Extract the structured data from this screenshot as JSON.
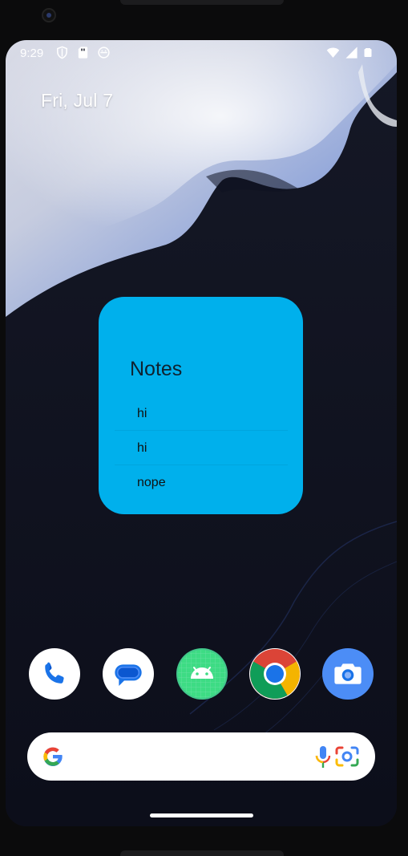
{
  "status_bar": {
    "time": "9:29",
    "left_icons": [
      "shield-icon",
      "sd-card-icon",
      "android-head-icon"
    ],
    "right_icons": [
      "wifi-icon",
      "signal-icon",
      "battery-icon"
    ]
  },
  "home": {
    "date": "Fri, Jul 7"
  },
  "notes_widget": {
    "title": "Notes",
    "background": "#00b0ec",
    "items": [
      {
        "text": "hi"
      },
      {
        "text": "hi"
      },
      {
        "text": "nope"
      }
    ]
  },
  "dock": {
    "apps": [
      {
        "name": "phone-app",
        "icon": "phone-icon"
      },
      {
        "name": "messages-app",
        "icon": "message-bubble-icon"
      },
      {
        "name": "android-app",
        "icon": "android-robot-icon"
      },
      {
        "name": "chrome-app",
        "icon": "chrome-icon"
      },
      {
        "name": "camera-app",
        "icon": "camera-icon"
      }
    ]
  },
  "search_bar": {
    "icons": [
      "google-g-icon",
      "microphone-icon",
      "google-lens-icon"
    ]
  },
  "colors": {
    "widget": "#00b0ec",
    "wallpaper_dark": "#0e1120",
    "wallpaper_light": "#9db2e6"
  }
}
